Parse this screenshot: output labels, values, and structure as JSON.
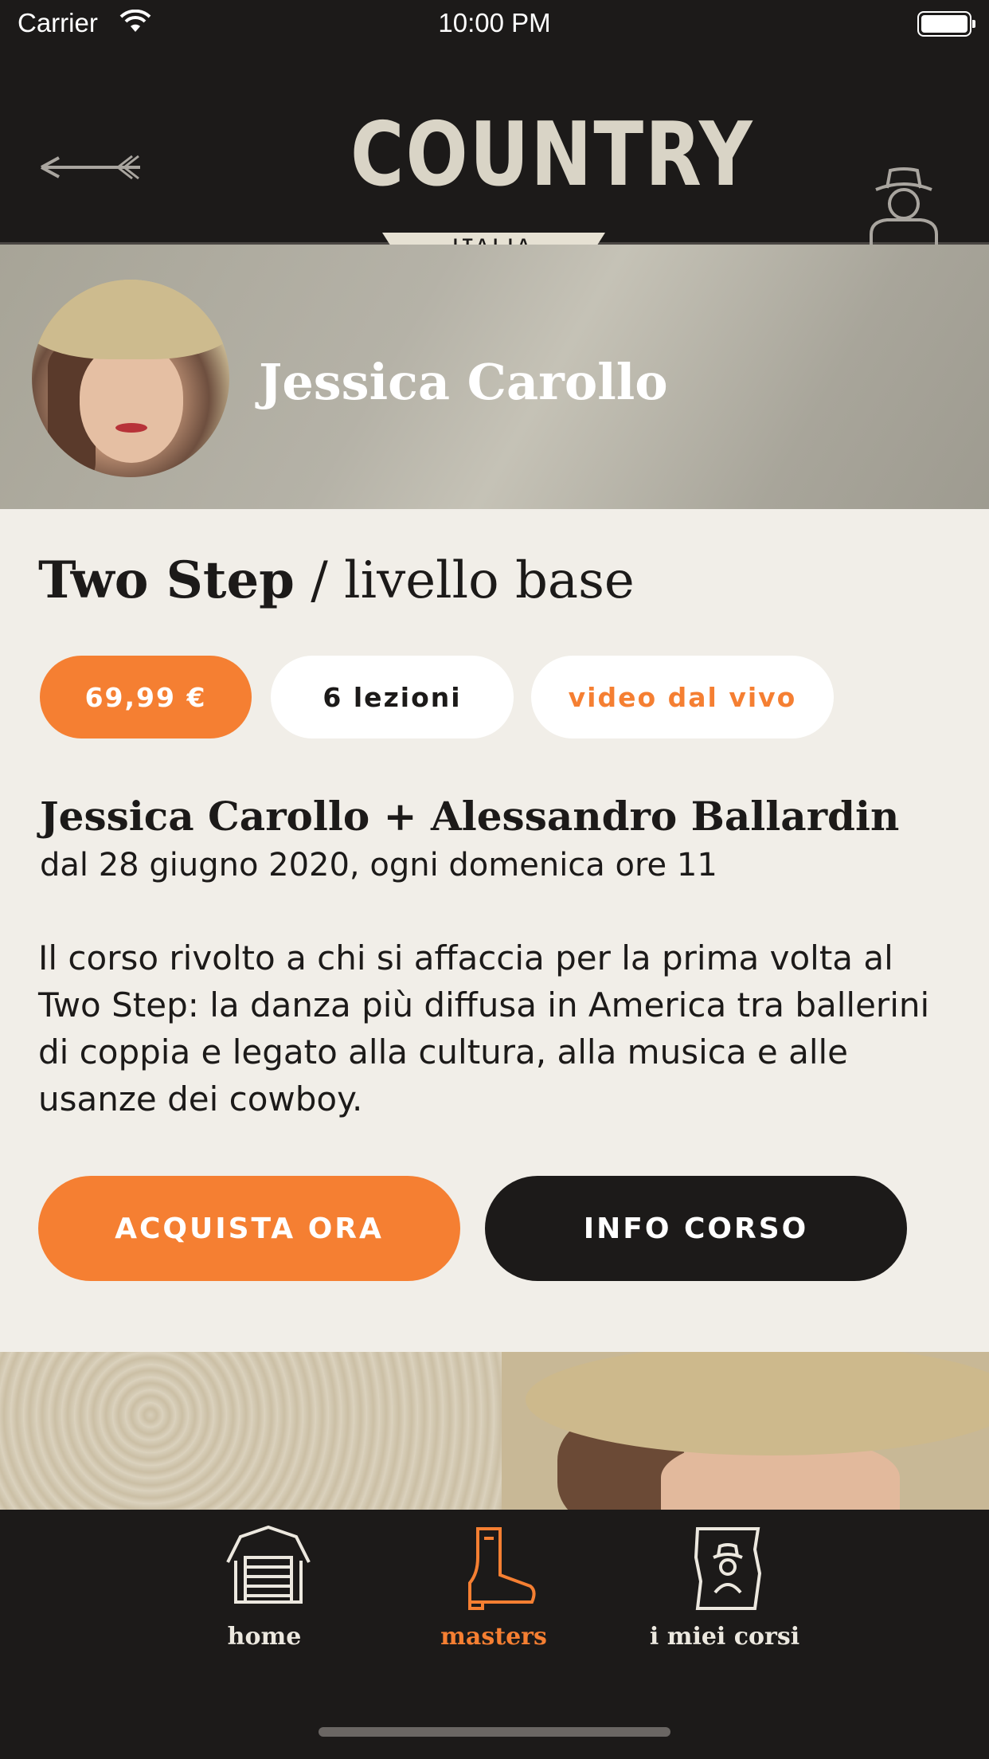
{
  "status_bar": {
    "carrier": "Carrier",
    "time": "10:00 PM"
  },
  "header": {
    "logo_word": "COUNTRY",
    "logo_sub": "ITALIA",
    "back_icon": "arrow-left-icon",
    "profile_icon": "cowboy-user-icon"
  },
  "instructor": {
    "name": "Jessica Carollo"
  },
  "course": {
    "title_bold": "Two Step",
    "title_rest": " / livello base",
    "price": "69,99 €",
    "lessons": "6 lezioni",
    "format": "video dal vivo",
    "teachers": "Jessica Carollo + Alessandro Ballardin",
    "schedule": "dal 28 giugno 2020, ogni domenica ore 11",
    "description": "Il corso rivolto a chi si affaccia per la prima volta al Two Step: la danza più diffusa in America tra ballerini di coppia e legato alla cultura, alla musica e alle usanze dei cowboy."
  },
  "actions": {
    "buy": "ACQUISTA ORA",
    "info": "INFO CORSO"
  },
  "tabs": [
    {
      "label": "home",
      "icon": "barn-icon",
      "active": false
    },
    {
      "label": "masters",
      "icon": "cowboy-boot-icon",
      "active": true
    },
    {
      "label": "i miei corsi",
      "icon": "wanted-poster-icon",
      "active": false
    }
  ],
  "colors": {
    "accent": "#f57f32",
    "dark": "#1c1a19",
    "card": "#f1eee8"
  }
}
